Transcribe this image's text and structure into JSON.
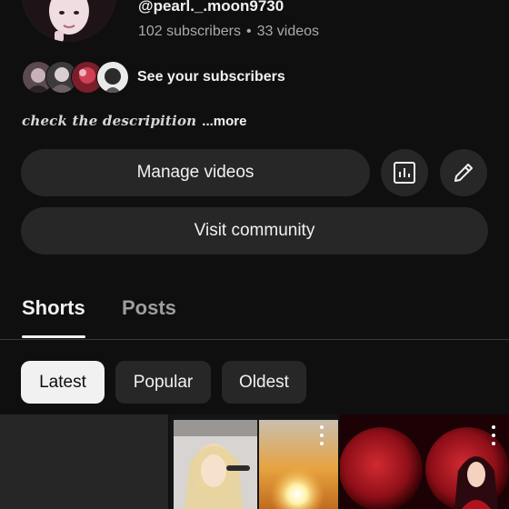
{
  "profile": {
    "handle": "@pearl._.moon9730",
    "subscribers": "102 subscribers",
    "separator": "•",
    "videos": "33 videos",
    "avatar_icon": "profile-avatar-image"
  },
  "subscribers_row": {
    "label": "See your subscribers",
    "avatar_count": 4
  },
  "description": {
    "text": "check the descripition",
    "more_label": "...more"
  },
  "actions": {
    "manage_label": "Manage videos",
    "stats_icon": "bar-chart-icon",
    "edit_icon": "pencil-icon",
    "community_label": "Visit community"
  },
  "tabs": [
    {
      "label": "Shorts",
      "selected": true
    },
    {
      "label": "Posts",
      "selected": false
    }
  ],
  "filters": [
    {
      "label": "Latest",
      "selected": true
    },
    {
      "label": "Popular",
      "selected": false
    },
    {
      "label": "Oldest",
      "selected": false
    }
  ],
  "shorts": [
    {
      "thumbnail": "dark-placeholder",
      "menu_icon": "more-vert-icon"
    },
    {
      "thumbnail": "blonde-singer-and-sunset",
      "menu_icon": "more-vert-icon"
    },
    {
      "thumbnail": "red-moon-portrait",
      "menu_icon": "more-vert-icon"
    }
  ],
  "colors": {
    "background": "#0f0f0f",
    "surface": "#272727",
    "text_primary": "#f1f1f1",
    "text_secondary": "#aaaaaa",
    "chip_selected_bg": "#f1f1f1",
    "chip_selected_text": "#0f0f0f",
    "tab_inactive": "#9e9e9e"
  }
}
